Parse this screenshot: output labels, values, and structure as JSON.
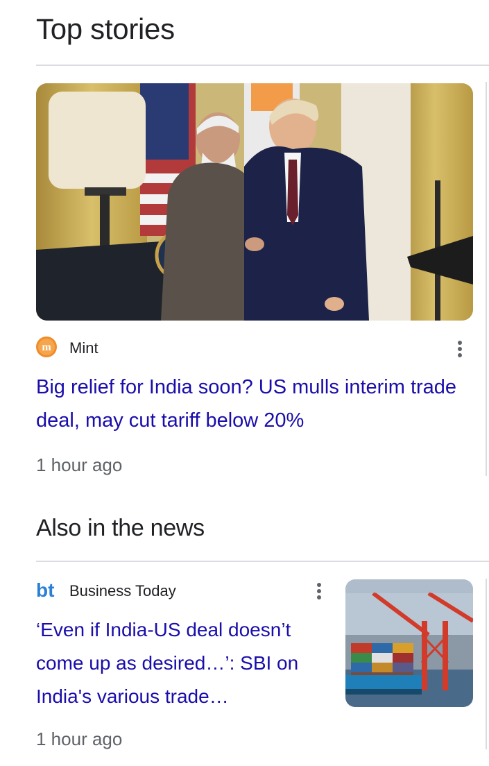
{
  "top_stories": {
    "title": "Top stories",
    "story": {
      "source": "Mint",
      "source_logo_letter": "m",
      "logo_color": "#f08c2a",
      "headline": "Big relief for India soon? US mulls interim trade deal, may cut tariff below 20%",
      "time": "1 hour ago",
      "image_icon": "press-conference-photo"
    }
  },
  "also_in_news": {
    "title": "Also in the news",
    "story": {
      "source": "Business Today",
      "source_logo_text": "bt",
      "logo_color": "#2a7fd4",
      "headline": "‘Even if India-US deal doesn’t come up as desired…’: SBI on India's various trade…",
      "time": "1 hour ago",
      "image_icon": "cargo-ship-cranes-photo"
    }
  },
  "colors": {
    "headline_link": "#1a0dab",
    "secondary_text": "#5f6368",
    "divider": "#dadce0"
  }
}
